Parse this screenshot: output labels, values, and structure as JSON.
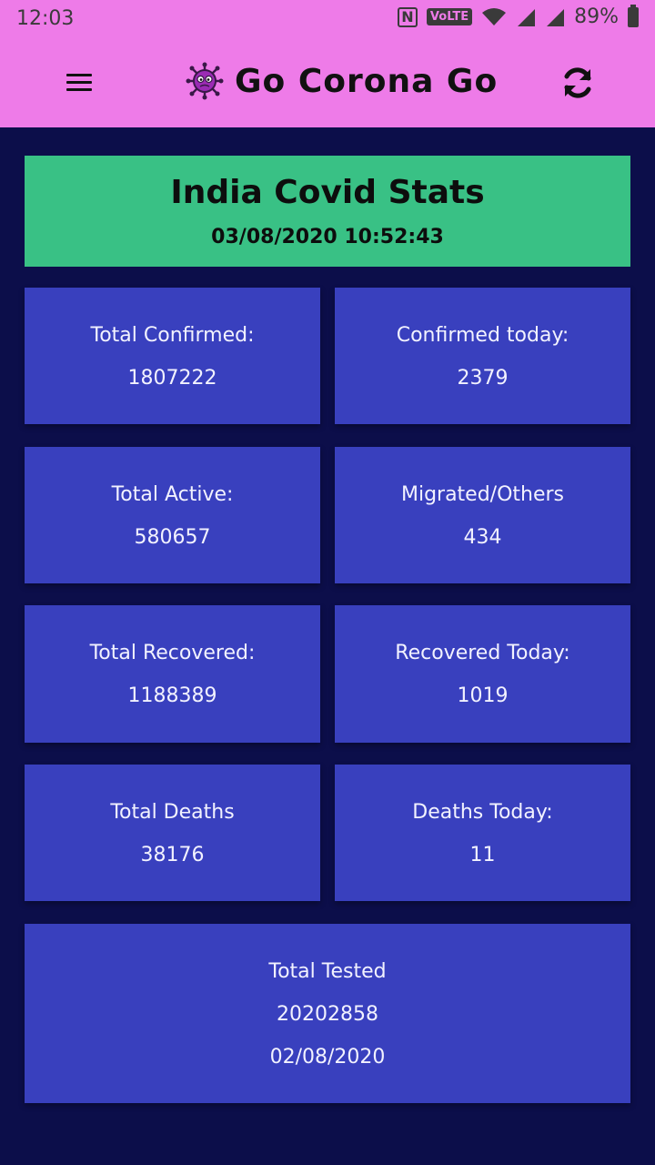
{
  "status_bar": {
    "time": "12:03",
    "volte": "VoLTE",
    "battery": "89%"
  },
  "toolbar": {
    "title": "Go Corona Go",
    "menu_icon": "hamburger-menu-icon",
    "logo_icon": "virus-icon",
    "refresh_icon": "refresh-icon"
  },
  "header": {
    "title": "India Covid Stats",
    "updated": "03/08/2020 10:52:43"
  },
  "stats": [
    {
      "label": "Total Confirmed:",
      "value": "1807222"
    },
    {
      "label": "Confirmed today:",
      "value": "2379"
    },
    {
      "label": "Total Active:",
      "value": "580657"
    },
    {
      "label": "Migrated/Others",
      "value": "434"
    },
    {
      "label": "Total Recovered:",
      "value": "1188389"
    },
    {
      "label": "Recovered Today:",
      "value": "1019"
    },
    {
      "label": "Total Deaths",
      "value": "38176"
    },
    {
      "label": "Deaths Today:",
      "value": "11"
    }
  ],
  "tested": {
    "label": "Total Tested",
    "value": "20202858",
    "date": "02/08/2020"
  },
  "colors": {
    "appbar": "#ee7be8",
    "background": "#0c0e4a",
    "header_card": "#39c185",
    "stat_card": "#3940be"
  }
}
